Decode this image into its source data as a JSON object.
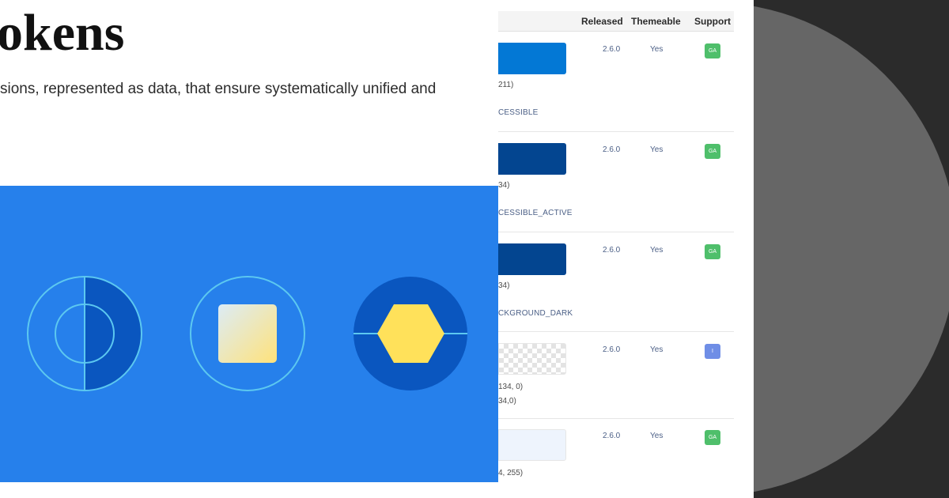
{
  "document": {
    "title_fragment": "okens",
    "description_fragment": "sions, represented as data, that ensure systematically unified and"
  },
  "table": {
    "headers": {
      "released": "Released",
      "themeable": "Themeable",
      "support": "Support"
    },
    "rows": [
      {
        "swatch_color": "#0378d5",
        "swatch_style": "solid",
        "value_line": "211)",
        "token_line": "CESSIBLE",
        "released": "2.6.0",
        "themeable": "Yes",
        "support": "GA",
        "support_color": "#4fbf6b"
      },
      {
        "swatch_color": "#034590",
        "swatch_style": "solid",
        "value_line": "34)",
        "token_line": "CESSIBLE_ACTIVE",
        "released": "2.6.0",
        "themeable": "Yes",
        "support": "GA",
        "support_color": "#4fbf6b"
      },
      {
        "swatch_color": "#034590",
        "swatch_style": "solid",
        "value_line": "34)",
        "token_line": "CKGROUND_DARK",
        "released": "2.6.0",
        "themeable": "Yes",
        "support": "GA",
        "support_color": "#4fbf6b"
      },
      {
        "swatch_color": "",
        "swatch_style": "checker",
        "value_line": "134, 0)",
        "value_line_2": "34,0)",
        "released": "2.6.0",
        "themeable": "Yes",
        "support": "I",
        "support_color": "#6f8ee6"
      },
      {
        "swatch_color": "#eef4fd",
        "swatch_style": "light",
        "value_line": "4, 255)",
        "released": "2.6.0",
        "themeable": "Yes",
        "support": "GA",
        "support_color": "#4fbf6b"
      }
    ]
  },
  "colors": {
    "hero_background": "#2680eb",
    "dark_blue": "#0a56bf",
    "accent_yellow": "#ffe15a",
    "ring_cyan": "#5cc8f0",
    "dark_panel": "#2b2b2b",
    "dark_circle": "#666666"
  },
  "icons": [
    "half-circle-ring-icon",
    "square-ring-icon",
    "hexagon-icon"
  ]
}
